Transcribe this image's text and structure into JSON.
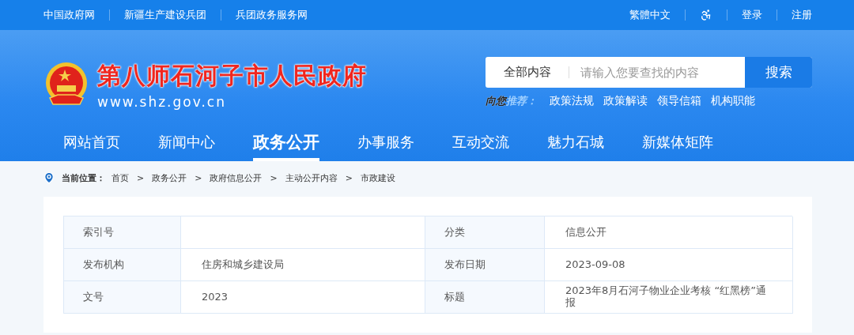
{
  "top_bar": {
    "left_links": [
      "中国政府网",
      "新疆生产建设兵团",
      "兵团政务服务网"
    ],
    "right_links": [
      {
        "kind": "text",
        "label": "繁體中文"
      },
      {
        "kind": "accessibility"
      },
      {
        "kind": "text",
        "label": "登录"
      },
      {
        "kind": "text",
        "label": "注册"
      }
    ]
  },
  "header": {
    "site_name": "第八师石河子市人民政府",
    "domain": "www.shz.gov.cn",
    "search": {
      "scope": "全部内容",
      "placeholder": "请输入您要查找的内容",
      "button": "搜索"
    },
    "recommend": {
      "label_dark": "向您",
      "label_light": "推荐：",
      "links": [
        "政策法规",
        "政策解读",
        "领导信箱",
        "机构职能"
      ]
    }
  },
  "nav": [
    {
      "label": "网站首页",
      "selected": false
    },
    {
      "label": "新闻中心",
      "selected": false
    },
    {
      "label": "政务公开",
      "selected": true
    },
    {
      "label": "办事服务",
      "selected": false
    },
    {
      "label": "互动交流",
      "selected": false
    },
    {
      "label": "魅力石城",
      "selected": false
    },
    {
      "label": "新媒体矩阵",
      "selected": false
    }
  ],
  "breadcrumb": {
    "label": "当前位置：",
    "separator": ">",
    "items": [
      "首页",
      "政务公开",
      "政府信息公开",
      "主动公开内容",
      "市政建设"
    ]
  },
  "info_table": [
    [
      {
        "label": "索引号"
      },
      {
        "label": "分类",
        "value": "信息公开"
      }
    ],
    [
      {
        "label": "发布机构",
        "value": "住房和城乡建设局"
      },
      {
        "label": "发布日期",
        "value": "2023-09-08"
      }
    ],
    [
      {
        "label": "文号",
        "value": "2023"
      },
      {
        "label": "标题",
        "value": "2023年8月石河子物业企业考核 “红黑榜”通报"
      }
    ]
  ]
}
